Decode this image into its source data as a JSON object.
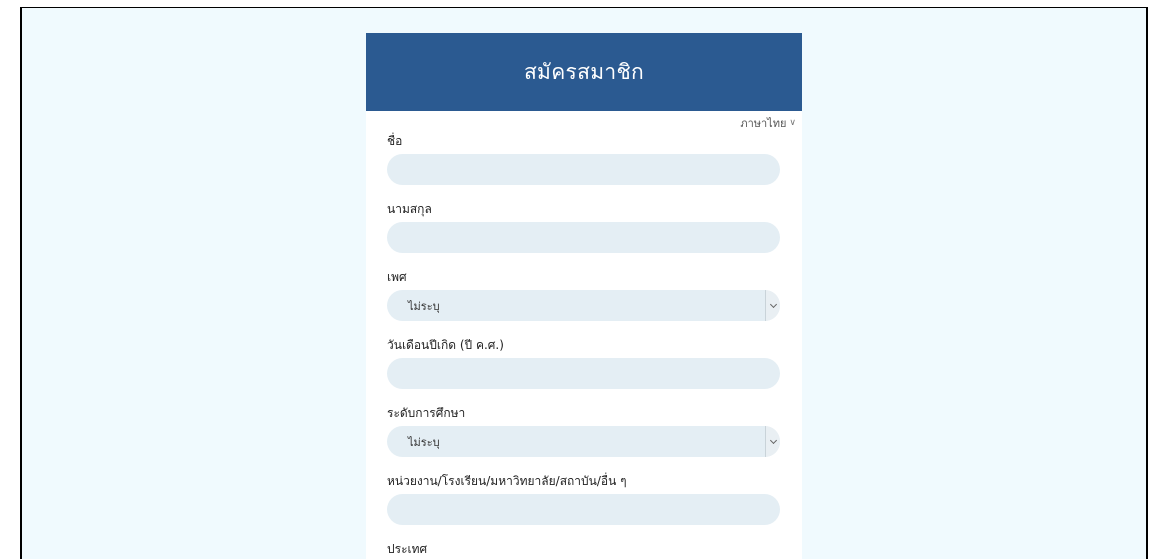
{
  "form": {
    "title": "สมัครสมาชิก",
    "language": "ภาษาไทย"
  },
  "fields": {
    "first_name": {
      "label": "ชื่อ",
      "value": ""
    },
    "last_name": {
      "label": "นามสกุล",
      "value": ""
    },
    "gender": {
      "label": "เพศ",
      "selected": "ไม่ระบุ"
    },
    "birthdate": {
      "label": "วันเดือนปีเกิด (ปี ค.ศ.)",
      "value": ""
    },
    "education": {
      "label": "ระดับการศึกษา",
      "selected": "ไม่ระบุ"
    },
    "organization": {
      "label": "หน่วยงาน/โรงเรียน/มหาวิทยาลัย/สถาบัน/อื่น ๆ",
      "value": ""
    },
    "country": {
      "label": "ประเทศ"
    }
  },
  "colors": {
    "header": "#2b5a91",
    "page_background": "#f0fafe",
    "input_background": "#e4eef4"
  },
  "icons": {
    "language_dropdown": "chevron-down-icon",
    "select_dropdown": "chevron-down-icon"
  }
}
